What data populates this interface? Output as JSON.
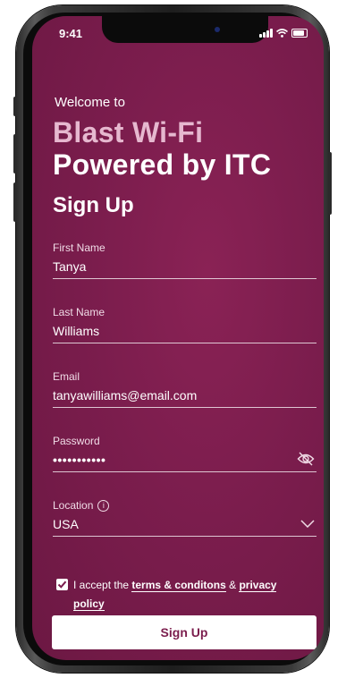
{
  "status_bar": {
    "time": "9:41"
  },
  "header": {
    "welcome": "Welcome to",
    "brand_line1": "Blast Wi-Fi",
    "brand_line2": "Powered by ITC",
    "title": "Sign Up"
  },
  "form": {
    "first_name": {
      "label": "First Name",
      "value": "Tanya"
    },
    "last_name": {
      "label": "Last Name",
      "value": "Williams"
    },
    "email": {
      "label": "Email",
      "value": "tanyawilliams@email.com"
    },
    "password": {
      "label": "Password",
      "value": "•••••••••••",
      "icon": "eye-slash-icon"
    },
    "location": {
      "label": "Location",
      "value": "USA",
      "info_icon": "info-icon",
      "dropdown_icon": "chevron-down-icon"
    }
  },
  "terms": {
    "checked": true,
    "prefix": "I accept the",
    "terms_link": "terms & conditons",
    "ampersand": "&",
    "privacy_link_part1": "privacy",
    "privacy_link_part2": "policy"
  },
  "button": {
    "label": "Sign Up"
  },
  "colors": {
    "background": "#7b1d4d",
    "brand_accent": "#e6b8cf",
    "button_bg": "#ffffff",
    "button_text": "#7b1d4d"
  }
}
